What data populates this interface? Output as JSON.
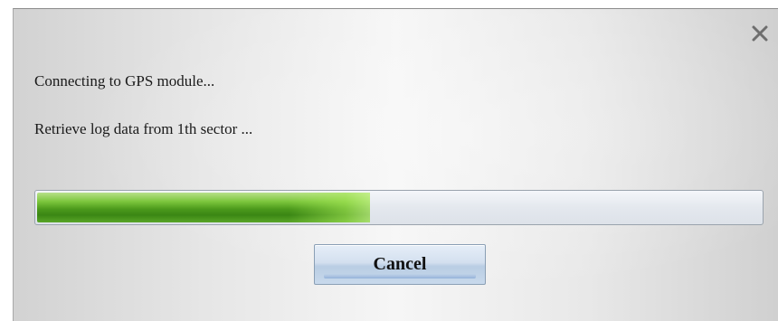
{
  "dialog": {
    "status_lines": [
      "Connecting to GPS module...",
      "Retrieve log data from 1th sector ..."
    ],
    "progress": {
      "fraction": 0.46,
      "fill_color": "#4c9a1c",
      "track_color": "#e4e8ee"
    },
    "cancel_label": "Cancel",
    "close_icon": "close-icon"
  }
}
